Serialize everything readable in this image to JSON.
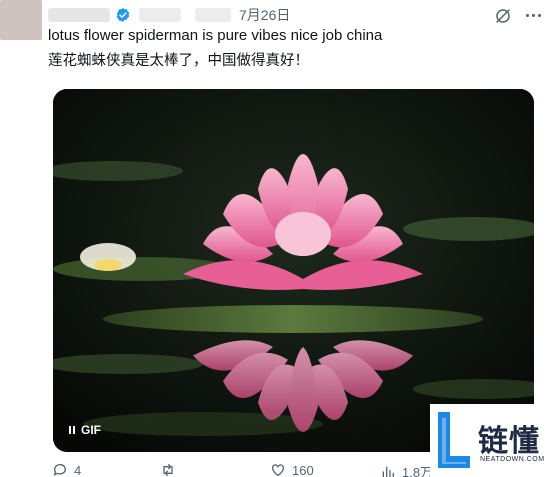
{
  "post": {
    "date": "7月26日",
    "text_en": "lotus flower spiderman is pure vibes nice job china",
    "text_zh": "莲花蜘蛛侠真是太棒了，中国做得真好！",
    "media_badge": "GIF"
  },
  "actions": {
    "replies": "4",
    "reposts": "",
    "likes": "160",
    "views": "1.8万"
  },
  "watermark": {
    "text": "链懂",
    "sub": "NEATDOWN.COM"
  },
  "colors": {
    "verified": "#1d9bf0",
    "muted": "#536471",
    "lotus": "#f08bb2",
    "watermark_blue": "#1e88e5"
  }
}
